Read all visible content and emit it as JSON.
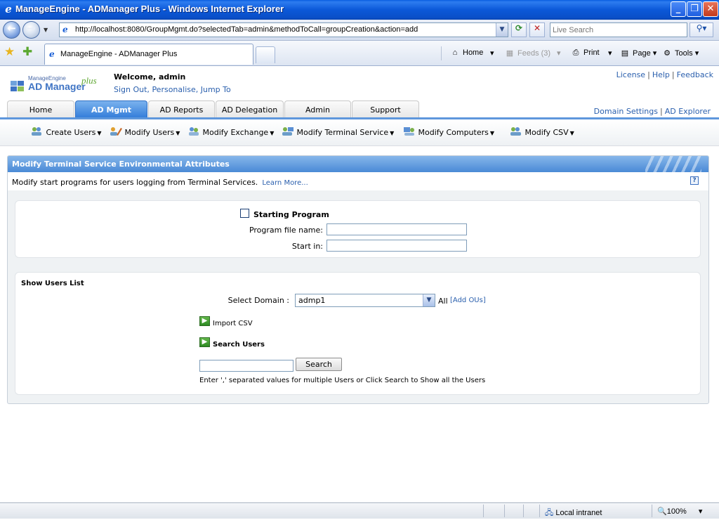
{
  "window": {
    "title": "ManageEngine - ADManager Plus - Windows Internet Explorer",
    "ie_icon": "e"
  },
  "addressbar": {
    "url": "http://localhost:8080/GroupMgmt.do?selectedTab=admin&methodToCall=groupCreation&action=add",
    "search_placeholder": "Live Search"
  },
  "browser_tab": {
    "label": "ManageEngine - ADManager Plus"
  },
  "commandbar": {
    "home": "Home",
    "feeds": "Feeds (3)",
    "print": "Print",
    "page": "Page",
    "tools": "Tools"
  },
  "header": {
    "logo_top": "ManageEngine",
    "logo_main": "AD Manager",
    "logo_plus": "plus",
    "welcome": "Welcome,  admin",
    "sign_out": "Sign Out,",
    "personalise": "Personalise,",
    "jump_to": "Jump To",
    "top_links": [
      "License",
      "Help",
      "Feedback"
    ],
    "right_links": [
      "Domain Settings",
      "AD Explorer"
    ]
  },
  "tabs": [
    {
      "label": "Home",
      "active": false
    },
    {
      "label": "AD Mgmt",
      "active": true
    },
    {
      "label": "AD Reports",
      "active": false
    },
    {
      "label": "AD Delegation",
      "active": false
    },
    {
      "label": "Admin",
      "active": false
    },
    {
      "label": "Support",
      "active": false
    }
  ],
  "subnav": [
    {
      "label": "Create Users",
      "icon": "users-add-icon"
    },
    {
      "label": "Modify Users",
      "icon": "users-edit-icon"
    },
    {
      "label": "Modify Exchange",
      "icon": "exchange-icon"
    },
    {
      "label": "Modify Terminal Service",
      "icon": "terminal-service-icon"
    },
    {
      "label": "Modify Computers",
      "icon": "computers-icon"
    },
    {
      "label": "Modify CSV",
      "icon": "csv-icon"
    }
  ],
  "panel": {
    "title": "Modify Terminal Service Environmental Attributes",
    "description": "Modify start programs for users logging from Terminal Services.",
    "learn_more": "Learn More...",
    "help": "?"
  },
  "form": {
    "starting_program_label": "Starting Program",
    "starting_program_checked": false,
    "program_file_label": "Program file name:",
    "program_file_value": "",
    "start_in_label": "Start in:",
    "start_in_value": ""
  },
  "users": {
    "section_title": "Show Users List",
    "domain_label": "Select Domain :",
    "domain_value": "admp1",
    "all_label": "All",
    "add_ous": "[Add OUs]",
    "import_csv": "Import CSV",
    "search_users": "Search Users",
    "search_value": "",
    "search_button": "Search",
    "hint": "Enter ',' separated values for multiple Users or Click Search to Show all the Users"
  },
  "statusbar": {
    "zone": "Local intranet",
    "zoom": "100%"
  },
  "colors": {
    "title_bar": "#0a58d8",
    "active_tab": "#2f7ad8",
    "panel_header": "#4a8ad6",
    "link": "#2a5fad"
  }
}
